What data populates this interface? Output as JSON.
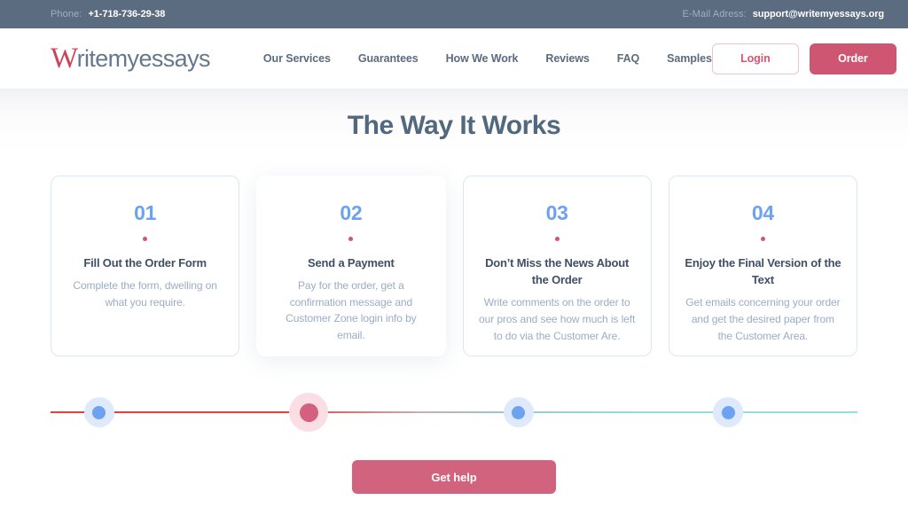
{
  "topbar": {
    "phone_label": "Phone:",
    "phone_value": "+1-718-736-29-38",
    "email_label": "E-Mail Adress:",
    "email_value": "support@writemyessays.org"
  },
  "header": {
    "logo_initial": "W",
    "logo_rest": "ritemyessays",
    "nav": [
      {
        "label": "Our Services"
      },
      {
        "label": "Guarantees"
      },
      {
        "label": "How We Work"
      },
      {
        "label": "Reviews"
      },
      {
        "label": "FAQ"
      },
      {
        "label": "Samples"
      }
    ],
    "login_label": "Login",
    "order_label": "Order"
  },
  "main": {
    "title": "The Way It Works",
    "cards": [
      {
        "number": "01",
        "title": "Fill Out the Order Form",
        "desc": "Complete the form, dwelling on what you require.",
        "active": false
      },
      {
        "number": "02",
        "title": "Send a Payment",
        "desc": "Pay for the order, get a confirmation message and Customer Zone login info by email.",
        "active": true
      },
      {
        "number": "03",
        "title": "Don’t Miss the News About the Order",
        "desc": "Write comments on the order to our pros and see how much is left to do via the Customer Are.",
        "active": false
      },
      {
        "number": "04",
        "title": "Enjoy the Final Version of the Text",
        "desc": "Get emails concerning your order and get the desired paper from the Customer Area.",
        "active": false
      }
    ],
    "stepper": [
      {
        "state": "done",
        "position_pct": 6
      },
      {
        "state": "active",
        "position_pct": 32
      },
      {
        "state": "upcoming",
        "position_pct": 58
      },
      {
        "state": "upcoming",
        "position_pct": 84
      }
    ],
    "cta_label": "Get help"
  },
  "colors": {
    "topbar_bg": "#5b6b80",
    "brand_red": "#cf4257",
    "accent_pink": "#d2637f",
    "accent_blue": "#6ca2f0",
    "title_slate": "#52687f",
    "body_muted": "#9badc4"
  }
}
